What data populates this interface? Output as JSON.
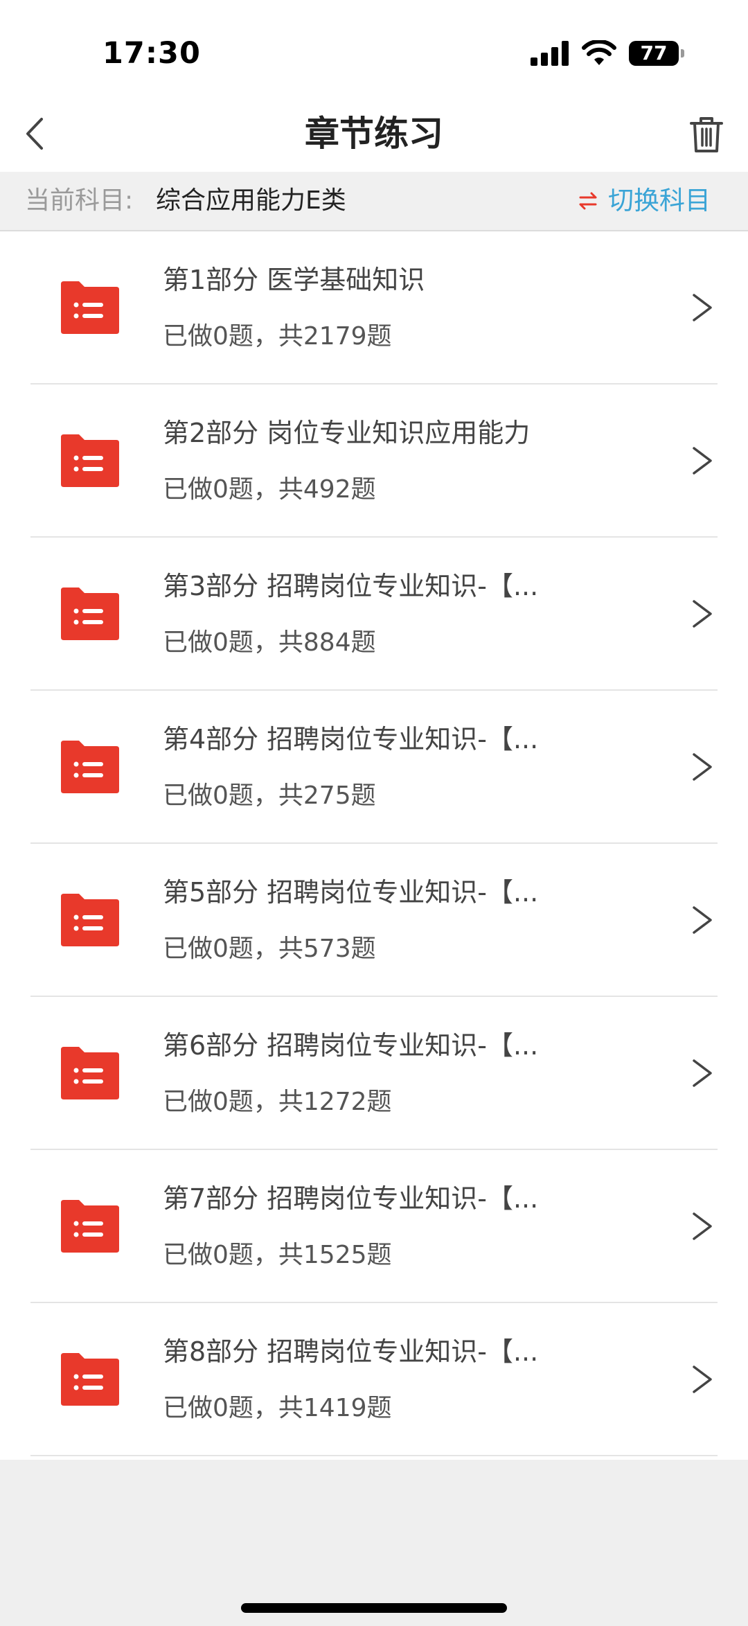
{
  "status_bar": {
    "time": "17:30",
    "battery": "77"
  },
  "nav": {
    "title": "章节练习"
  },
  "subject": {
    "label": "当前科目:",
    "name": "综合应用能力E类",
    "switch_label": "切换科目"
  },
  "colors": {
    "folder_red": "#e8392b",
    "switch_blue": "#3aa4d6",
    "switch_arrow_red": "#e8392b"
  },
  "chapters": [
    {
      "title": "第1部分  医学基础知识",
      "meta": "已做0题，共2179题"
    },
    {
      "title": "第2部分  岗位专业知识应用能力",
      "meta": "已做0题，共492题"
    },
    {
      "title": "第3部分  招聘岗位专业知识-【...",
      "meta": "已做0题，共884题"
    },
    {
      "title": "第4部分  招聘岗位专业知识-【...",
      "meta": "已做0题，共275题"
    },
    {
      "title": "第5部分  招聘岗位专业知识-【...",
      "meta": "已做0题，共573题"
    },
    {
      "title": "第6部分  招聘岗位专业知识-【...",
      "meta": "已做0题，共1272题"
    },
    {
      "title": "第7部分  招聘岗位专业知识-【...",
      "meta": "已做0题，共1525题"
    },
    {
      "title": "第8部分  招聘岗位专业知识-【...",
      "meta": "已做0题，共1419题"
    }
  ]
}
